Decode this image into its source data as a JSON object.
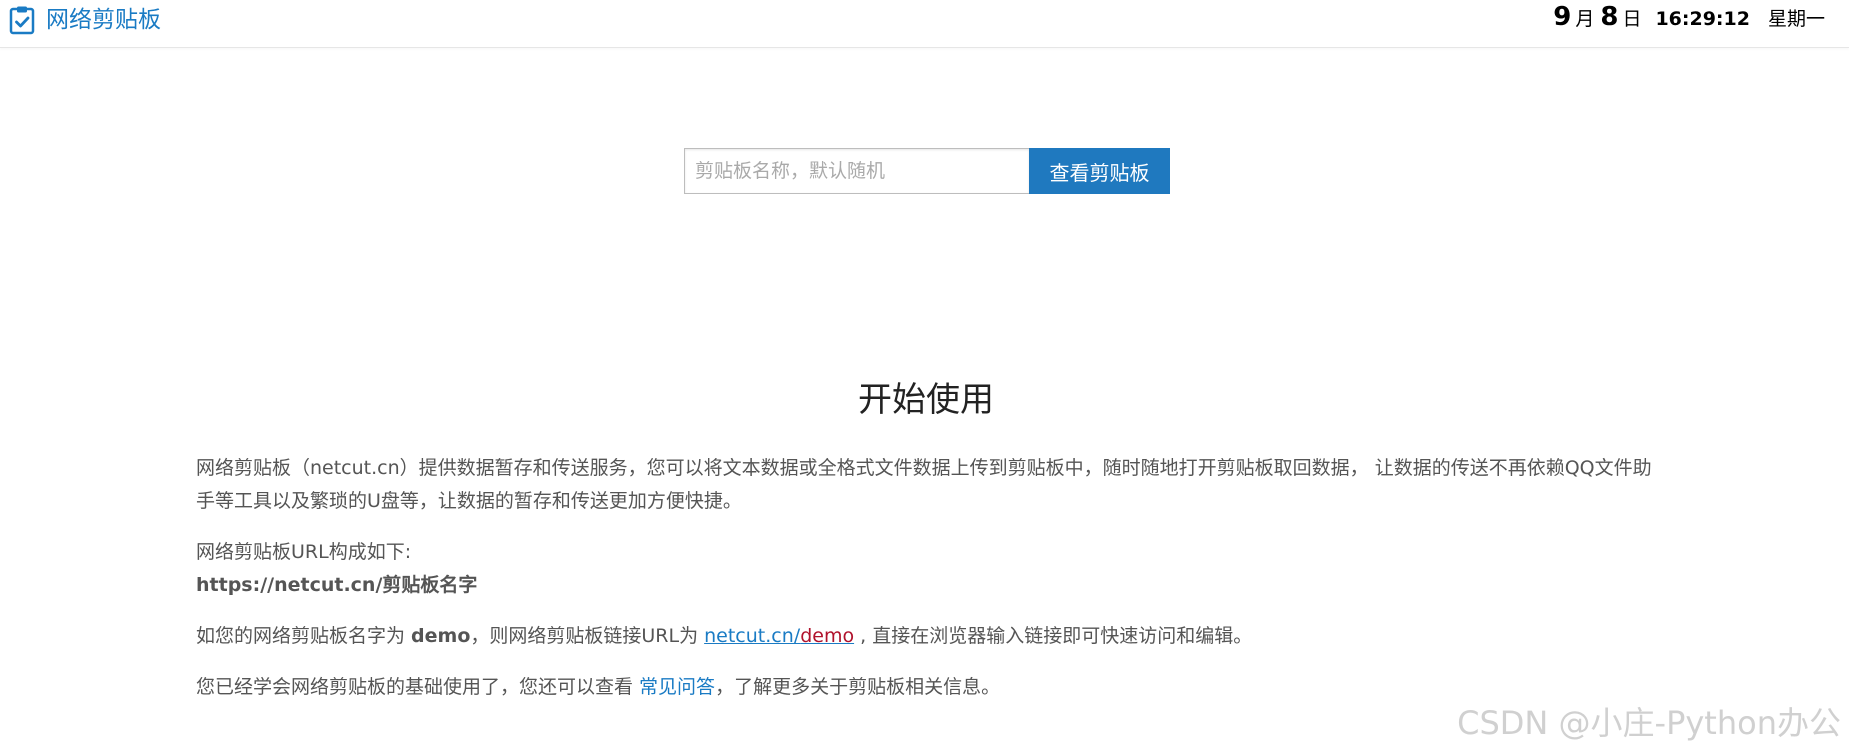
{
  "header": {
    "brand": "网络剪贴板",
    "clock": {
      "month": "9",
      "month_unit": "月",
      "day": "8",
      "day_unit": "日",
      "time": "16:29:12",
      "weekday": "星期一"
    }
  },
  "search": {
    "placeholder": "剪贴板名称，默认随机",
    "button": "查看剪贴板",
    "accent": "#1f79bf"
  },
  "main": {
    "title": "开始使用",
    "p1": "网络剪贴板（netcut.cn）提供数据暂存和传送服务，您可以将文本数据或全格式文件数据上传到剪贴板中，随时随地打开剪贴板取回数据， 让数据的传送不再依赖QQ文件助手等工具以及繁琐的U盘等，让数据的暂存和传送更加方便快捷。",
    "p2_label": "网络剪贴板URL构成如下:",
    "p2_url": "https://netcut.cn/剪贴板名字",
    "p3_prefix": "如您的网络剪贴板名字为 ",
    "p3_name": "demo",
    "p3_mid": "，则网络剪贴板链接URL为 ",
    "p3_link_base": "netcut.cn/",
    "p3_link_demo": "demo",
    "p3_suffix": " , 直接在浏览器输入链接即可快速访问和编辑。",
    "p4_prefix": "您已经学会网络剪贴板的基础使用了，您还可以查看 ",
    "p4_link": "常见问答",
    "p4_suffix": "，了解更多关于剪贴板相关信息。"
  },
  "watermark": "CSDN @小庄-Python办公",
  "icons": {
    "brand": "clipboard-check-icon"
  },
  "colors": {
    "brand": "#1a7bc4",
    "link_demo": "#b0122c"
  }
}
